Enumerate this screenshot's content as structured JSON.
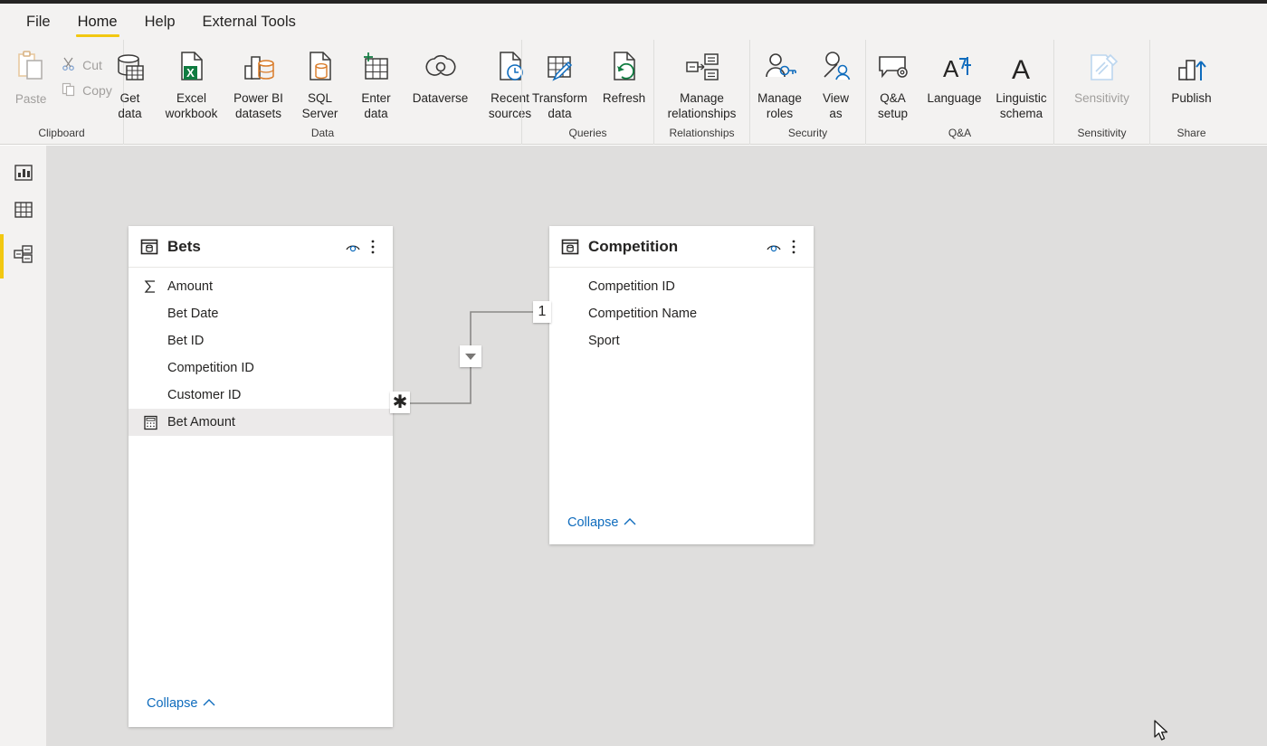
{
  "ribbon": {
    "tabs": [
      {
        "label": "File",
        "active": false
      },
      {
        "label": "Home",
        "active": true
      },
      {
        "label": "Help",
        "active": false
      },
      {
        "label": "External Tools",
        "active": false
      }
    ],
    "accent_color": "#f2c811",
    "groups": {
      "clipboard": {
        "label": "Clipboard",
        "paste": "Paste",
        "cut": "Cut",
        "copy": "Copy"
      },
      "data": {
        "label": "Data",
        "items": [
          {
            "label": "Get\ndata",
            "caret": true
          },
          {
            "label": "Excel\nworkbook",
            "caret": false
          },
          {
            "label": "Power BI\ndatasets",
            "caret": false
          },
          {
            "label": "SQL\nServer",
            "caret": false
          },
          {
            "label": "Enter\ndata",
            "caret": false
          },
          {
            "label": "Dataverse",
            "caret": false
          },
          {
            "label": "Recent\nsources",
            "caret": true
          }
        ]
      },
      "queries": {
        "label": "Queries",
        "items": [
          {
            "label": "Transform\ndata",
            "caret": true
          },
          {
            "label": "Refresh",
            "caret": false
          }
        ]
      },
      "relationships": {
        "label": "Relationships",
        "items": [
          {
            "label": "Manage\nrelationships",
            "caret": false
          }
        ]
      },
      "security": {
        "label": "Security",
        "items": [
          {
            "label": "Manage\nroles",
            "caret": false
          },
          {
            "label": "View\nas",
            "caret": false
          }
        ]
      },
      "qanda": {
        "label": "Q&A",
        "items": [
          {
            "label": "Q&A\nsetup",
            "caret": false
          },
          {
            "label": "Language",
            "caret": true
          },
          {
            "label": "Linguistic\nschema",
            "caret": true
          }
        ]
      },
      "sensitivity": {
        "label": "Sensitivity",
        "items": [
          {
            "label": "Sensitivity",
            "caret": true,
            "disabled": true
          }
        ]
      },
      "share": {
        "label": "Share",
        "items": [
          {
            "label": "Publish",
            "caret": false
          }
        ]
      }
    }
  },
  "viewbar": {
    "items": [
      {
        "name": "report-view",
        "icon": "bar-chart-icon",
        "active": false
      },
      {
        "name": "data-view",
        "icon": "table-icon",
        "active": false
      },
      {
        "name": "model-view",
        "icon": "model-relationships-icon",
        "active": true
      }
    ]
  },
  "canvas": {
    "background_color": "#dfdedd",
    "tables": [
      {
        "name": "Bets",
        "icon": "table-icon",
        "fields": [
          {
            "label": "Amount",
            "icon": "sigma-icon"
          },
          {
            "label": "Bet Date",
            "icon": "none"
          },
          {
            "label": "Bet ID",
            "icon": "none"
          },
          {
            "label": "Competition ID",
            "icon": "none"
          },
          {
            "label": "Customer ID",
            "icon": "none"
          },
          {
            "label": "Bet Amount",
            "icon": "measure-calculator-icon",
            "selected": true
          }
        ],
        "collapse_label": "Collapse"
      },
      {
        "name": "Competition",
        "icon": "table-icon",
        "fields": [
          {
            "label": "Competition ID",
            "icon": "none"
          },
          {
            "label": "Competition Name",
            "icon": "none"
          },
          {
            "label": "Sport",
            "icon": "none"
          }
        ],
        "collapse_label": "Collapse"
      }
    ],
    "relationship": {
      "many_marker": "✱",
      "one_marker": "1",
      "direction_icon": "filter-direction-down-icon"
    }
  }
}
